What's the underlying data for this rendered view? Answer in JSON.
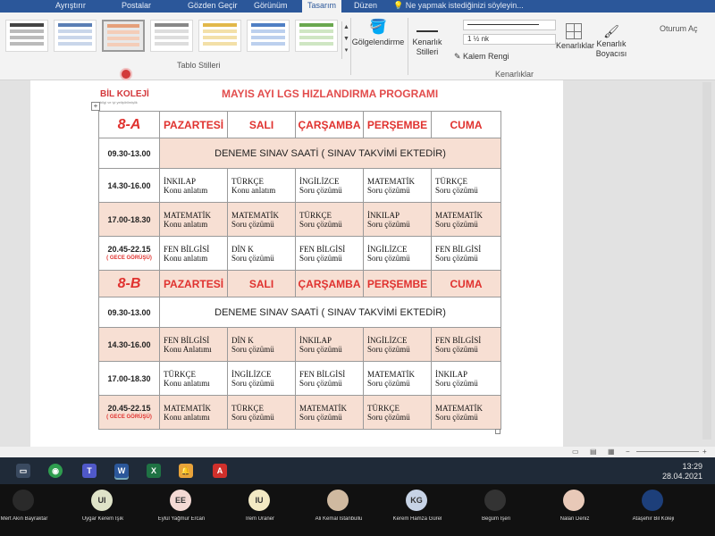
{
  "ribbon": {
    "tabs": [
      "Ayrıştırır",
      "Postalar",
      "Gözden Geçir",
      "Görünüm",
      "Tasarım",
      "Düzen"
    ],
    "active_tab": "Tasarım",
    "tell_me": "Ne yapmak istediğinizi söyleyin...",
    "sign_in": "Oturum Aç",
    "table_styles_label": "Tablo Stilleri",
    "shading_label": "Gölgelendirme",
    "border_styles_label": "Kenarlık Stilleri",
    "line_weight": "1 ½ nk",
    "pen_color_label": "Kalem Rengi",
    "borders_label": "Kenarlıklar",
    "border_painter_label": "Kenarlık Boyacısı",
    "borders_group_label": "Kenarlıklar"
  },
  "document": {
    "logo_name": "BİL KOLEJİ",
    "logo_tagline": "bilgi ve iyi yetiştirilmişlik",
    "title": "MAYIS AYI LGS HIZLANDIRMA PROGRAMI",
    "days": [
      "PAZARTESİ",
      "SALI",
      "ÇARŞAMBA",
      "PERŞEMBE",
      "CUMA"
    ],
    "sections": [
      {
        "class": "8-A",
        "exam_time": "09.30-13.00",
        "exam_text": "DENEME SINAV SAATİ ( SINAV TAKVİMİ EKTEDİR)",
        "rows": [
          {
            "time": "14.30-16.00",
            "note": "",
            "cells": [
              [
                "İNKILAP",
                "Konu anlatım"
              ],
              [
                "TÜRKÇE",
                "Konu anlatım"
              ],
              [
                "İNGİLİZCE",
                "Soru çözümü"
              ],
              [
                "MATEMATİK",
                "Soru çözümü"
              ],
              [
                "TÜRKÇE",
                "Soru çözümü"
              ]
            ]
          },
          {
            "time": "17.00-18.30",
            "note": "",
            "cells": [
              [
                "MATEMATİK",
                "Konu anlatım"
              ],
              [
                "MATEMATİK",
                "Soru çözümü"
              ],
              [
                "TÜRKÇE",
                "Soru çözümü"
              ],
              [
                "İNKILAP",
                "Soru çözümü"
              ],
              [
                "MATEMATİK",
                "Soru çözümü"
              ]
            ]
          },
          {
            "time": "20.45-22.15",
            "note": "( GECE GÖRÜŞÜ)",
            "cells": [
              [
                "FEN BİLGİSİ",
                "Konu anlatım"
              ],
              [
                "DİN K",
                "Soru çözümü"
              ],
              [
                "FEN BİLGİSİ",
                "Soru çözümü"
              ],
              [
                "İNGİLİZCE",
                "Soru çözümü"
              ],
              [
                "FEN BİLGİSİ",
                "Soru çözümü"
              ]
            ]
          }
        ]
      },
      {
        "class": "8-B",
        "exam_time": "09.30-13.00",
        "exam_text": "DENEME SINAV SAATİ ( SINAV TAKVİMİ EKTEDİR)",
        "rows": [
          {
            "time": "14.30-16.00",
            "note": "",
            "cells": [
              [
                "FEN BİLGİSİ",
                "Konu Anlatımı"
              ],
              [
                "DİN K",
                "Soru çözümü"
              ],
              [
                "İNKILAP",
                "Soru çözümü"
              ],
              [
                "İNGİLİZCE",
                "Soru çözümü"
              ],
              [
                "FEN BİLGİSİ",
                "Soru çözümü"
              ]
            ]
          },
          {
            "time": "17.00-18.30",
            "note": "",
            "cells": [
              [
                "TÜRKÇE",
                "Konu anlatımı"
              ],
              [
                "İNGİLİZCE",
                "Soru çözümü"
              ],
              [
                "FEN BİLGİSİ",
                "Soru çözümü"
              ],
              [
                "MATEMATİK",
                "Soru çözümü"
              ],
              [
                "İNKILAP",
                "Soru çözümü"
              ]
            ]
          },
          {
            "time": "20.45-22.15",
            "note": "( GECE GÖRÜŞÜ)",
            "cells": [
              [
                "MATEMATİK",
                "Konu anlatımı"
              ],
              [
                "TÜRKÇE",
                "Soru çözümü"
              ],
              [
                "MATEMATİK",
                "Soru çözümü"
              ],
              [
                "TÜRKÇE",
                "Soru çözümü"
              ],
              [
                "MATEMATİK",
                "Soru çözümü"
              ]
            ]
          }
        ]
      }
    ]
  },
  "taskbar": {
    "time": "13:29",
    "date": "28.04.2021",
    "apps": [
      "zoom",
      "chrome",
      "teams",
      "word",
      "excel",
      "bell",
      "pdf"
    ]
  },
  "participants": [
    {
      "initials": "",
      "name": "Mert Akın Bayraktar"
    },
    {
      "initials": "UI",
      "name": "Uygar Kerem Işık"
    },
    {
      "initials": "EE",
      "name": "Eylül Yağmur Ercan"
    },
    {
      "initials": "IU",
      "name": "İrem Uraner"
    },
    {
      "initials": "",
      "name": "Ali Kemal İstanbullu"
    },
    {
      "initials": "KG",
      "name": "Kerem Hamza Gürel"
    },
    {
      "initials": "",
      "name": "Begüm İşeri"
    },
    {
      "initials": "",
      "name": "Nalan Deniz"
    },
    {
      "initials": "",
      "name": "Ataşehir Bil Koleji"
    }
  ],
  "colors": {
    "accent_red": "#e0322f",
    "row_pink": "#f7dfd3",
    "word_blue": "#2b579a"
  }
}
